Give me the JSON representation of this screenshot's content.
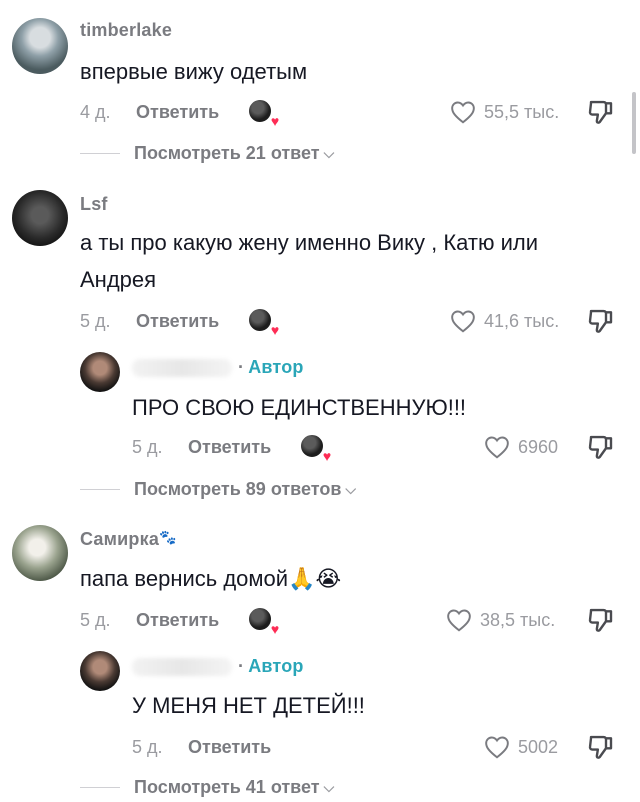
{
  "comments": [
    {
      "username": "timberlake",
      "text": "впервые вижу одетым",
      "time": "4 д.",
      "reply_label": "Ответить",
      "likes": "55,5 тыс.",
      "view_more": "Посмотреть 21 ответ"
    },
    {
      "username": "Lsf",
      "text_line1": "а ты про какую жену именно Вику , Катю или",
      "text_line2": "Андрея",
      "time": "5 д.",
      "reply_label": "Ответить",
      "likes": "41,6 тыс.",
      "reply": {
        "author_tag": "Автор",
        "author_dot": "·",
        "text": "ПРО СВОЮ ЕДИНСТВЕННУЮ!!!",
        "time": "5 д.",
        "reply_label": "Ответить",
        "likes": "6960"
      },
      "view_more": "Посмотреть 89 ответов"
    },
    {
      "username": "Самирка",
      "username_emoji": "🐾",
      "text": "папа вернись домой",
      "text_emoji": "🙏😭",
      "time": "5 д.",
      "reply_label": "Ответить",
      "likes": "38,5 тыс.",
      "reply": {
        "author_tag": "Автор",
        "author_dot": "·",
        "text": "У МЕНЯ НЕТ ДЕТЕЙ!!!",
        "time": "5 д.",
        "reply_label": "Ответить",
        "likes": "5002"
      },
      "view_more": "Посмотреть 41 ответ"
    }
  ],
  "icons": {
    "like": "heart-outline-icon",
    "dislike": "thumbs-down-icon",
    "chevron": "chevron-down-icon",
    "creator_liked": "creator-heart-badge"
  },
  "colors": {
    "author_tag": "#2aa6b8",
    "heart_badge": "#fe2c55",
    "muted": "#7a7b80"
  }
}
